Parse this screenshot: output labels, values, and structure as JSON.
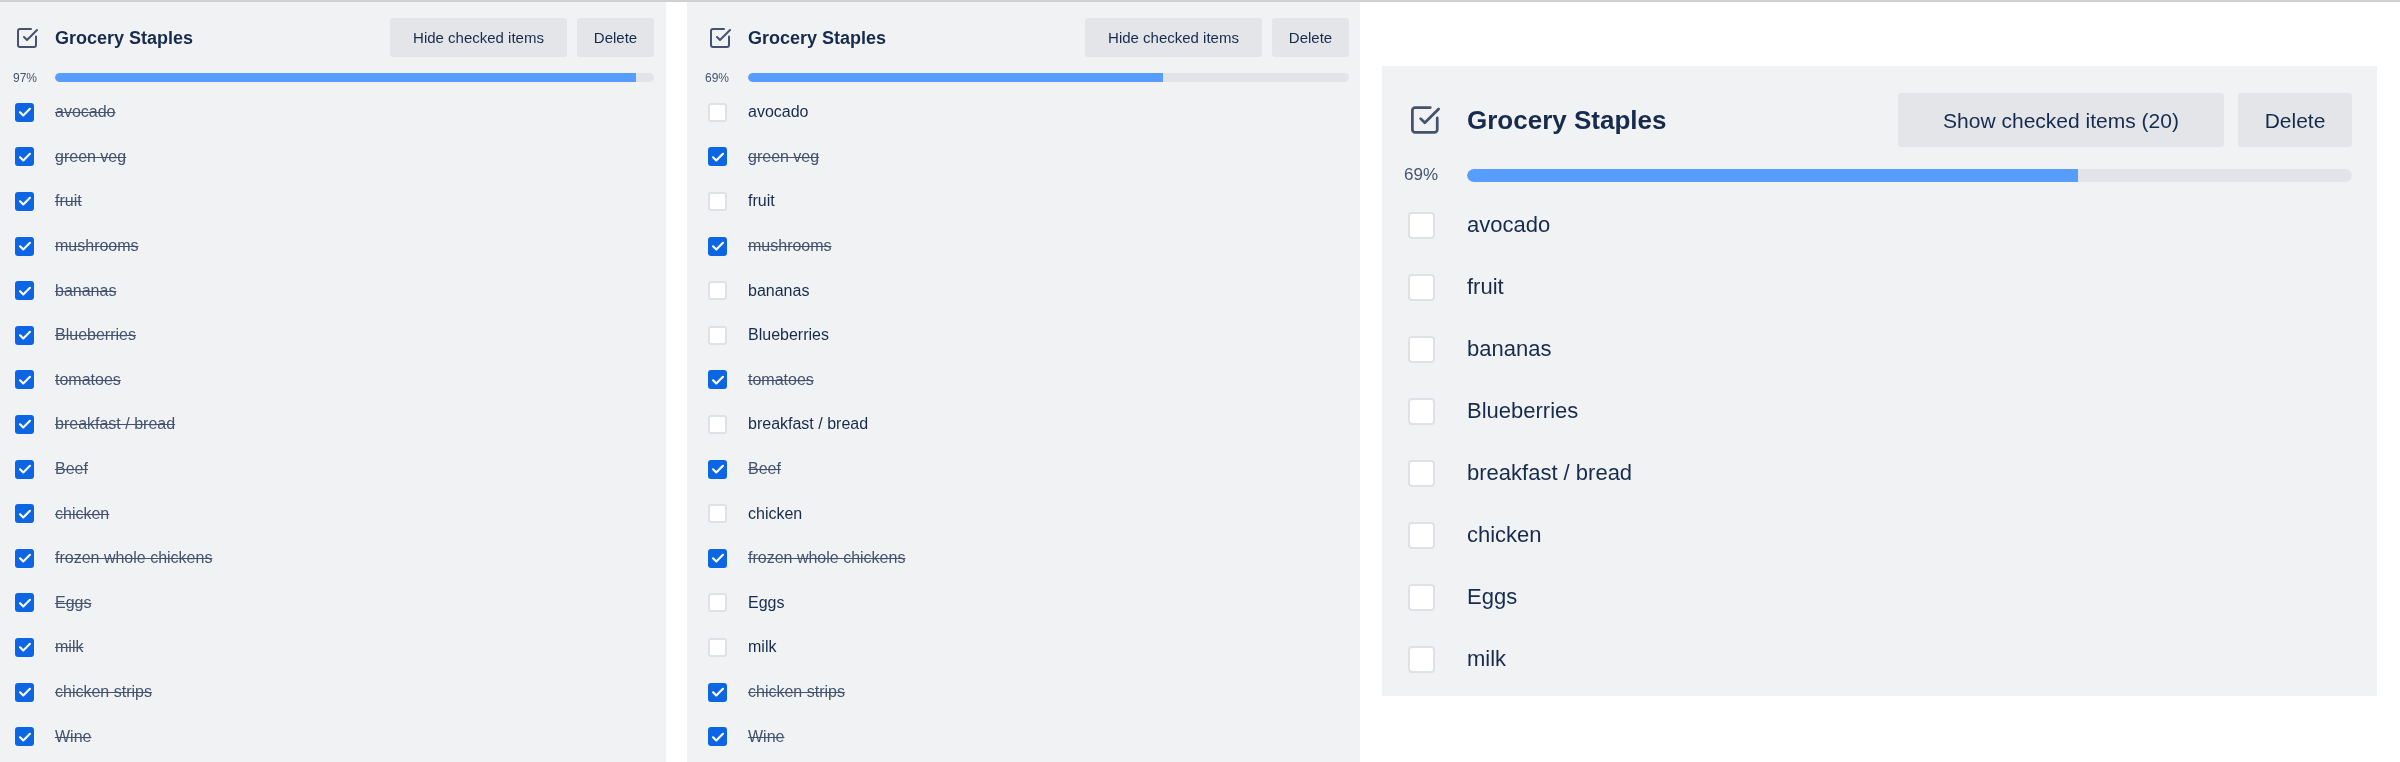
{
  "panels": [
    {
      "title": "Grocery Staples",
      "buttons": [
        "Hide checked items",
        "Delete"
      ],
      "progress": {
        "reading": "97%",
        "level": 0.97
      },
      "items": [
        {
          "label": "avocado",
          "checked": true
        },
        {
          "label": "green veg",
          "checked": true
        },
        {
          "label": "fruit",
          "checked": true
        },
        {
          "label": "mushrooms",
          "checked": true
        },
        {
          "label": "bananas",
          "checked": true
        },
        {
          "label": "Blueberries",
          "checked": true
        },
        {
          "label": "tomatoes",
          "checked": true
        },
        {
          "label": "breakfast / bread",
          "checked": true
        },
        {
          "label": "Beef",
          "checked": true
        },
        {
          "label": "chicken",
          "checked": true
        },
        {
          "label": "frozen whole chickens",
          "checked": true
        },
        {
          "label": "Eggs",
          "checked": true
        },
        {
          "label": "milk",
          "checked": true
        },
        {
          "label": "chicken strips",
          "checked": true
        },
        {
          "label": "Wine",
          "checked": true
        }
      ]
    },
    {
      "title": "Grocery Staples",
      "buttons": [
        "Hide checked items",
        "Delete"
      ],
      "progress": {
        "reading": "69%",
        "level": 0.69
      },
      "items": [
        {
          "label": "avocado",
          "checked": false
        },
        {
          "label": "green veg",
          "checked": true
        },
        {
          "label": "fruit",
          "checked": false
        },
        {
          "label": "mushrooms",
          "checked": true
        },
        {
          "label": "bananas",
          "checked": false
        },
        {
          "label": "Blueberries",
          "checked": false
        },
        {
          "label": "tomatoes",
          "checked": true
        },
        {
          "label": "breakfast / bread",
          "checked": false
        },
        {
          "label": "Beef",
          "checked": true
        },
        {
          "label": "chicken",
          "checked": false
        },
        {
          "label": "frozen whole chickens",
          "checked": true
        },
        {
          "label": "Eggs",
          "checked": false
        },
        {
          "label": "milk",
          "checked": false
        },
        {
          "label": "chicken strips",
          "checked": true
        },
        {
          "label": "Wine",
          "checked": true
        }
      ]
    },
    {
      "title": "Grocery Staples",
      "buttons": [
        "Show checked items (20)",
        "Delete"
      ],
      "progress": {
        "reading": "69%",
        "level": 0.69
      },
      "items": [
        {
          "label": "avocado",
          "checked": false
        },
        {
          "label": "fruit",
          "checked": false
        },
        {
          "label": "bananas",
          "checked": false
        },
        {
          "label": "Blueberries",
          "checked": false
        },
        {
          "label": "breakfast / bread",
          "checked": false
        },
        {
          "label": "chicken",
          "checked": false
        },
        {
          "label": "Eggs",
          "checked": false
        },
        {
          "label": "milk",
          "checked": false
        }
      ]
    }
  ]
}
